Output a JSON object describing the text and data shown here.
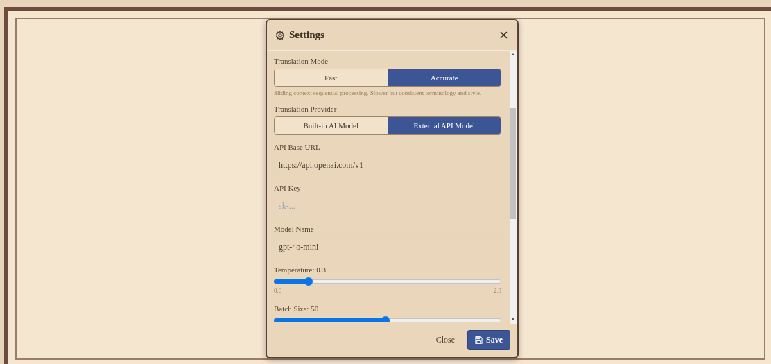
{
  "dialog": {
    "title": "Settings",
    "settings": [
      {
        "kind": "segmented",
        "label": "Translation Mode",
        "options": [
          {
            "label": "Fast",
            "selected": false
          },
          {
            "label": "Accurate",
            "selected": true
          }
        ],
        "hint": "Sliding context sequential processing. Slower but consistent terminology and style."
      },
      {
        "kind": "segmented",
        "label": "Translation Provider",
        "options": [
          {
            "label": "Built-in AI Model",
            "selected": false
          },
          {
            "label": "External API Model",
            "selected": true
          }
        ]
      },
      {
        "kind": "text",
        "label": "API Base URL",
        "value": "https://api.openai.com/v1"
      },
      {
        "kind": "text",
        "label": "API Key",
        "placeholder": "sk-..."
      },
      {
        "kind": "text",
        "label": "Model Name",
        "value": "gpt-4o-mini"
      },
      {
        "kind": "slider",
        "label": "Temperature: 0.3",
        "level": 0.15,
        "min_label": "0.0",
        "max_label": "2.0"
      },
      {
        "kind": "slider",
        "label": "Batch Size: 50",
        "level": 0.49
      }
    ],
    "buttons": [
      {
        "kind": "plain",
        "label": "Close"
      },
      {
        "kind": "primary",
        "label": "Save"
      }
    ]
  }
}
